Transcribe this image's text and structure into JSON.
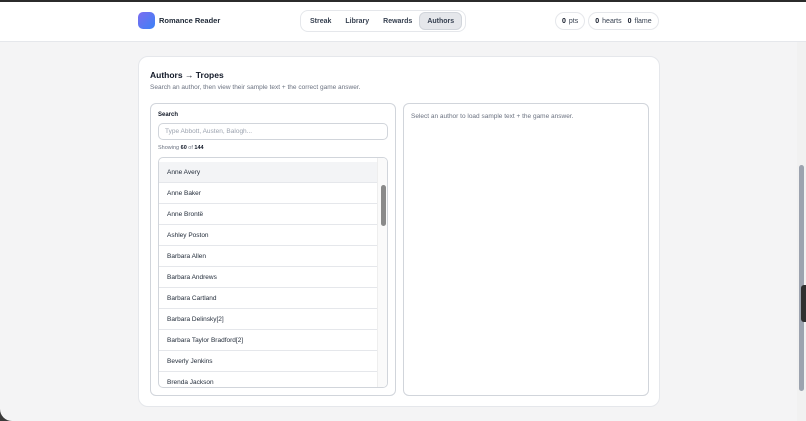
{
  "header": {
    "brand_name": "Romance Reader",
    "nav": [
      {
        "label": "Streak",
        "active": false
      },
      {
        "label": "Library",
        "active": false
      },
      {
        "label": "Rewards",
        "active": false
      },
      {
        "label": "Authors",
        "active": true
      }
    ],
    "stats": {
      "pts_value": "0",
      "pts_label": "pts",
      "hearts_value": "0",
      "hearts_label": "hearts",
      "flame_value": "0",
      "flame_label": "flame"
    }
  },
  "panel": {
    "title": "Authors → Tropes",
    "subtitle": "Search an author, then view their sample text + the correct game answer.",
    "search": {
      "label": "Search",
      "placeholder": "Type Abbott, Austen, Balogh...",
      "value": ""
    },
    "count": {
      "prefix": "Showing",
      "shown": "60",
      "of": "of",
      "total": "144"
    },
    "authors": [
      "Anne Avery",
      "Anne Baker",
      "Anne Brontë",
      "Ashley Poston",
      "Barbara Allen",
      "Barbara Andrews",
      "Barbara Cartland",
      "Barbara Delinsky[2]",
      "Barbara Taylor Bradford[2]",
      "Beverly Jenkins",
      "Brenda Jackson"
    ],
    "detail_message": "Select an author to load sample text + the game answer."
  },
  "colors": {
    "accent": "#7c6cf0",
    "accent_2": "#3b82f6",
    "active_tab_bg": "#e5e7eb"
  }
}
